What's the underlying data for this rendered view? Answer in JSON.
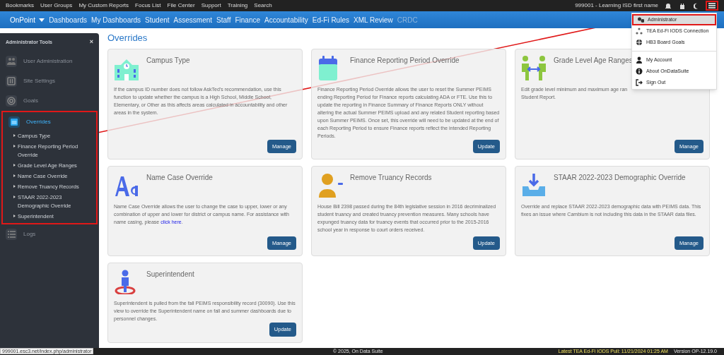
{
  "top_links": [
    "Bookmarks",
    "User Groups",
    "My Custom Reports",
    "Focus List",
    "File Center",
    "Support",
    "Training",
    "Search"
  ],
  "account": "999001 - Learning ISD first name",
  "nav": [
    {
      "label": "OnPoint",
      "kind": "dropdown",
      "disabled": false
    },
    {
      "label": "Dashboards",
      "kind": "link",
      "disabled": false
    },
    {
      "label": "My Dashboards",
      "kind": "link",
      "disabled": false
    },
    {
      "label": "Student",
      "kind": "link",
      "disabled": false
    },
    {
      "label": "Assessment",
      "kind": "link",
      "disabled": false
    },
    {
      "label": "Staff",
      "kind": "link",
      "disabled": false
    },
    {
      "label": "Finance",
      "kind": "link",
      "disabled": false
    },
    {
      "label": "Accountability",
      "kind": "link",
      "disabled": false
    },
    {
      "label": "Ed-Fi Rules",
      "kind": "link",
      "disabled": false
    },
    {
      "label": "XML Review",
      "kind": "link",
      "disabled": false
    },
    {
      "label": "CRDC",
      "kind": "link",
      "disabled": true
    }
  ],
  "menu": [
    [
      {
        "label": "Administrator",
        "selected": true
      },
      {
        "label": "TEA Ed-Fi IODS Connection",
        "selected": false
      },
      {
        "label": "HB3 Board Goals",
        "selected": false
      }
    ],
    [
      {
        "label": "My Account",
        "selected": false
      },
      {
        "label": "About OnDataSuite",
        "selected": false
      },
      {
        "label": "Sign Out",
        "selected": false
      }
    ]
  ],
  "sidebar": {
    "title": "Administrator Tools",
    "close": "×",
    "items": [
      {
        "label": "User Administration",
        "selected": false
      },
      {
        "label": "Site Settings",
        "selected": false
      },
      {
        "label": "Goals",
        "selected": false
      },
      {
        "label": "Overrides",
        "selected": true,
        "children": [
          "Campus Type",
          "Finance Reporting Period Override",
          "Grade Level Age Ranges",
          "Name Case Override",
          "Remove Truancy Records",
          "STAAR 2022-2023 Demographic Override",
          "Superintendent"
        ]
      },
      {
        "label": "Logs",
        "selected": false
      }
    ]
  },
  "page_title": "Overrides",
  "cards": [
    {
      "title": "Campus Type",
      "description": "If the campus ID number does not follow AskTed's recommendation, use this function to update whether the campus is a High School, Middle School, Elementary, or Other as this affects areas calculated in accountability and other areas in the system.",
      "button": "Manage"
    },
    {
      "title": "Finance Reporting Period Override",
      "description": "Finance Reporting Period Override allows the user to reset the Summer PEIMS ending Reporting Period for Finance reports calculating ADA or FTE. Use this to update the reporting in Finance Summary of Finance Reports ONLY without altering the actual Summer PEIMS upload and any related Student reporting based upon Summer PEIMS. Once set, this override will need to be updated at the end of each Reporting Period to ensure Finance reports reflect the intended Reporting Periods.",
      "button": "Update"
    },
    {
      "title": "Grade Level Age Ranges",
      "description": "Edit grade level minimum and maximum age ran",
      "description_line_2": "Student Report.",
      "button": "Manage"
    },
    {
      "title": "Name Case Override",
      "description": "Name Case Override allows the user to change the case to upper, lower or any combination of upper and lower for district or campus name. For assistance with name casing, please",
      "link": "click here",
      "description_end": ".",
      "button": "Manage"
    },
    {
      "title": "Remove Truancy Records",
      "description": "House Bill 2398 passed during the 84th legislative session in 2016 decriminalized student truancy and created truancy prevention measures. Many schools have expunged truancy data for truancy events that occurred prior to the 2015-2016 school year in response to court orders received.",
      "button": "Update"
    },
    {
      "title": "STAAR 2022-2023 Demographic Override",
      "description": "Override and replace STAAR 2022-2023 demographic data with PEIMS data. This fixes an issue where Cambium is not including this data in the STAAR data files.",
      "button": "Manage"
    },
    {
      "title": "Superintendent",
      "description": "Superintendent is pulled from the fall PEIMS responsibility record (30090). Use this view to override the Superintendent name on fall and summer dashboards due to personnel changes.",
      "button": "Update"
    }
  ],
  "footer": {
    "copyright": "© 2025, On Data Suite",
    "pull": "Latest TEA Ed-Fi IODS Pull: 11/21/2024 01:25 AM",
    "version": "Version OP-12.19.0"
  },
  "status_url": "999001.esc3.net/index.php/administrator"
}
